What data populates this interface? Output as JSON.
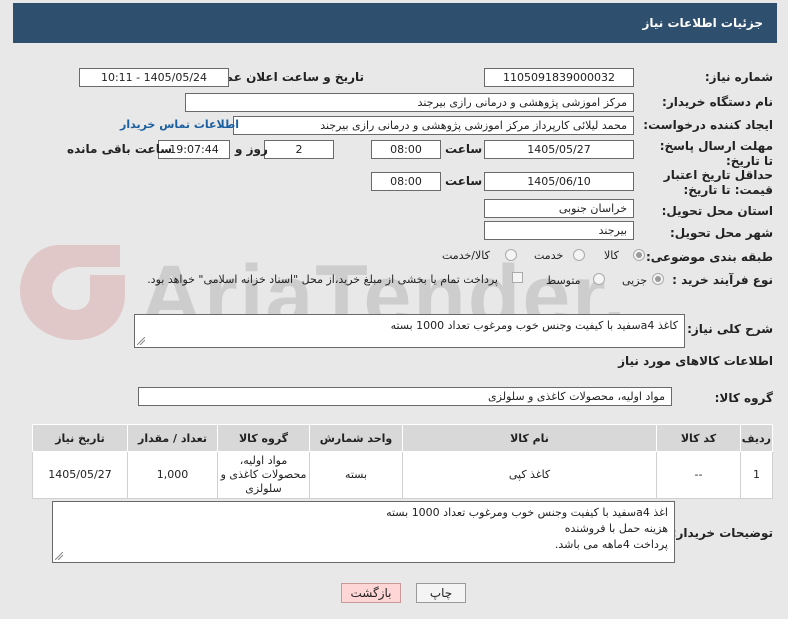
{
  "header": {
    "title": "جزئیات اطلاعات نیاز"
  },
  "form": {
    "need_number_label": "شماره نیاز:",
    "need_number": "1105091839000032",
    "announce_label": "تاریخ و ساعت اعلان عمومی:",
    "announce_value": "1405/05/24 - 10:11",
    "buyer_label": "نام دستگاه خریدار:",
    "buyer_value": "مرکز اموزشی پژوهشی و درمانی رازی بیرجند",
    "creator_label": "ایجاد کننده درخواست:",
    "creator_value": "محمد لیلائی کارپرداز مرکز اموزشی پژوهشی و درمانی رازی بیرجند",
    "contact_link": "اطلاعات تماس خریدار",
    "deadline_label": "مهلت ارسال پاسخ: تا تاریخ:",
    "deadline_date": "1405/05/27",
    "time_word": "ساعت",
    "deadline_time": "08:00",
    "days_value": "2",
    "days_word": "روز و",
    "remaining_time": "19:07:44",
    "remaining_label": "ساعت باقی مانده",
    "price_label": "حداقل تاریخ اعتبار قیمت: تا تاریخ:",
    "price_date": "1405/06/10",
    "price_time": "08:00",
    "province_label": "استان محل تحویل:",
    "province_value": "خراسان جنوبی",
    "city_label": "شهر محل تحویل:",
    "city_value": "بیرجند",
    "category_label": "طبقه بندی موضوعی:",
    "category_options": [
      "کالا",
      "خدمت",
      "کالا/خدمت"
    ],
    "process_label": "نوع فرآیند خرید :",
    "process_options": [
      "جزیی",
      "متوسط"
    ],
    "payment_note": "پرداخت تمام یا بخشی از مبلغ خرید،از محل \"اسناد خزانه اسلامی\" خواهد بود."
  },
  "description": {
    "label": "شرح کلی نیاز:",
    "text": "کاغذ a4سفید با کیفیت  وجنس خوب  ومرغوب تعداد 1000 بسته"
  },
  "goods": {
    "section_title": "اطلاعات کالاهای مورد نیاز",
    "group_label": "گروه کالا:",
    "group_value": "مواد اولیه، محصولات کاغذی و سلولزی",
    "columns": [
      "ردیف",
      "کد کالا",
      "نام کالا",
      "واحد شمارش",
      "گروه کالا",
      "تعداد / مقدار",
      "تاریخ نیاز"
    ],
    "rows": [
      {
        "row": "1",
        "code": "--",
        "name": "کاغذ کپی",
        "unit": "بسته",
        "group_line1": "مواد اولیه،",
        "group_line2": "محصولات کاغذی و",
        "group_line3": "سلولزی",
        "quantity": "1,000",
        "date": "1405/05/27"
      }
    ]
  },
  "buyer_notes": {
    "label": "توضیحات خریدار:",
    "line1": "اغذ a4سفید با کیفیت  وجنس خوب ومرغوب تعداد 1000 بسته",
    "line2": "هزینه حمل با فروشنده",
    "line3": "پرداخت 4ماهه می باشد."
  },
  "buttons": {
    "print": "چاپ",
    "back": "بازگشت"
  },
  "watermark": {
    "text": "AriaTender.neT"
  },
  "colors": {
    "header_bg": "#2f4f6f",
    "page_bg": "#e8e8e8",
    "link": "#1a5fa0",
    "back_button": "#ffd6d6"
  }
}
